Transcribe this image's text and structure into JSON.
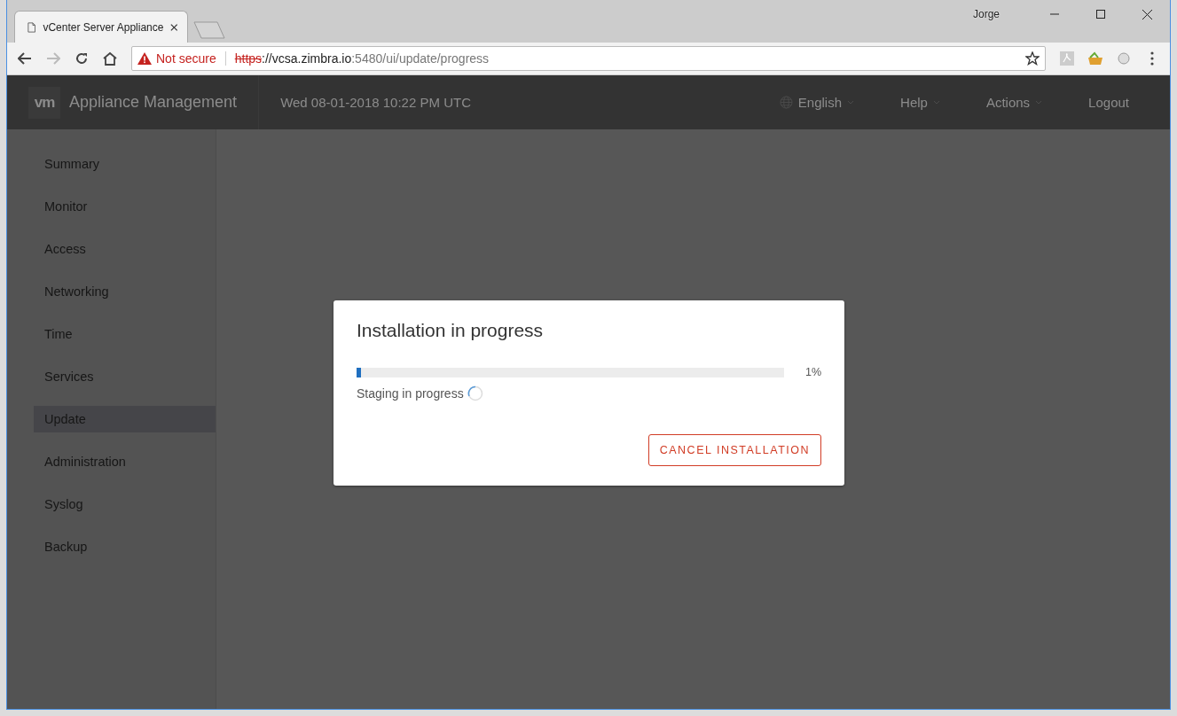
{
  "browser": {
    "tabs": [
      {
        "title": "vCenter Server Appliance",
        "selected": true
      }
    ],
    "profile": "Jorge",
    "address": {
      "security": "Not secure",
      "scheme": "https",
      "host": "://vcsa.zimbra.io",
      "path": ":5480/ui/update/progress"
    }
  },
  "header": {
    "logo": "vm",
    "title": "Appliance Management",
    "datetime": "Wed 08-01-2018 10:22 PM UTC",
    "nav": [
      {
        "label": "English",
        "kind": "language"
      },
      {
        "label": "Help",
        "kind": "dropdown"
      },
      {
        "label": "Actions",
        "kind": "dropdown"
      },
      {
        "label": "Logout",
        "kind": "link"
      }
    ]
  },
  "sidebar": {
    "items": [
      {
        "label": "Summary",
        "selected": false
      },
      {
        "label": "Monitor",
        "selected": false
      },
      {
        "label": "Access",
        "selected": false
      },
      {
        "label": "Networking",
        "selected": false
      },
      {
        "label": "Time",
        "selected": false
      },
      {
        "label": "Services",
        "selected": false
      },
      {
        "label": "Update",
        "selected": true
      },
      {
        "label": "Administration",
        "selected": false
      },
      {
        "label": "Syslog",
        "selected": false
      },
      {
        "label": "Backup",
        "selected": false
      }
    ]
  },
  "modal": {
    "title": "Installation in progress",
    "progress": {
      "level": 0.01,
      "reading": "1%"
    },
    "status": "Staging in progress",
    "button": "CANCEL INSTALLATION"
  }
}
